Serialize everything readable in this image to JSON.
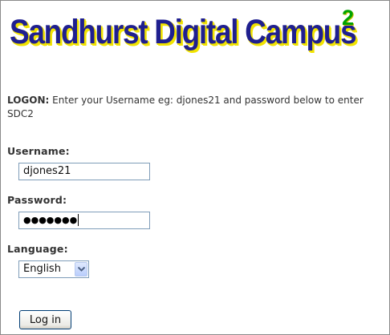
{
  "logo": {
    "title": "Sandhurst Digital Campus",
    "superscript": "2"
  },
  "intro": {
    "lead": "LOGON:",
    "text": " Enter your Username eg: djones21 and password below to enter SDC2"
  },
  "form": {
    "username_label": "Username:",
    "username_value": "djones21",
    "password_label": "Password:",
    "password_masked": "●●●●●●●",
    "language_label": "Language:",
    "language_selected": "English",
    "login_label": "Log in"
  },
  "colors": {
    "logo_text": "#1f1f8f",
    "logo_shadow": "#f1e300",
    "logo_superscript": "#00a300",
    "input_border": "#7f9db9",
    "button_border": "#003c74"
  }
}
